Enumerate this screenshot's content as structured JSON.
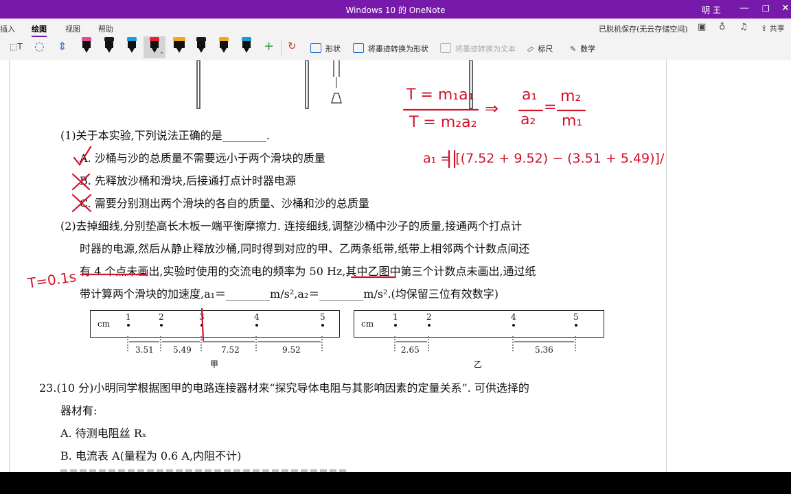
{
  "window": {
    "title": "Windows 10 的 OneNote",
    "user": "明 王"
  },
  "ribbon": {
    "tabs": [
      "插入",
      "绘图",
      "视图",
      "帮助"
    ],
    "active_tab": "绘图",
    "status": "已脱机保存(无云存储空间)",
    "share_label": "共享",
    "buttons": {
      "shape": "形状",
      "ink_to_shape": "将墨迹转换为形状",
      "ink_to_text": "将墨迹转换为文本",
      "ruler": "标尺",
      "math": "数学"
    },
    "pen_colors": [
      "#e14d8d",
      "#1a1a1a",
      "#18a0d8",
      "#e8222a",
      "#f2a81d",
      "#1a1a1a",
      "#f2a81d",
      "#1d9bd8"
    ]
  },
  "page": {
    "q1": {
      "stem": "(1)关于本实验,下列说法正确的是________.",
      "opt_a": "A. 沙桶与沙的总质量不需要远小于两个滑块的质量",
      "opt_b": "B. 先释放沙桶和滑块,后接通打点计时器电源",
      "opt_c": "C. 需要分别测出两个滑块的各自的质量、沙桶和沙的总质量"
    },
    "q2": {
      "line1": "(2)去掉细线,分别垫高长木板一端平衡摩擦力. 连接细线,调整沙桶中沙子的质量,接通两个打点计",
      "line2": "时器的电源,然后从静止释放沙桶,同时得到对应的甲、乙两条纸带,纸带上相邻两个计数点间还",
      "line3": "有 4 个点未画出,实验时使用的交流电的频率为 50 Hz,其中乙图中第三个计数点未画出,通过纸",
      "line4": "带计算两个滑块的加速度,a₁＝________m/s²,a₂＝________m/s².(均保留三位有效数字)"
    },
    "tape_jia": {
      "unit": "cm",
      "points": [
        "1",
        "2",
        "3",
        "4",
        "5"
      ],
      "gaps": [
        "3.51",
        "5.49",
        "7.52",
        "9.52"
      ],
      "label": "甲"
    },
    "tape_yi": {
      "unit": "cm",
      "points": [
        "1",
        "2",
        "4",
        "5"
      ],
      "gaps": [
        "2.65",
        "5.36"
      ],
      "label": "乙"
    },
    "q23": {
      "line1": "23.(10 分)小明同学根据图甲的电路连接器材来“探究导体电阻与其影响因素的定量关系”. 可供选择的",
      "line2": "器材有:",
      "opt_a": "A. 待测电阻丝 Rₓ",
      "opt_b": "B. 电流表 A(量程为 0.6 A,内阻不计)"
    },
    "ink": {
      "eq1": "T = m₁a₁",
      "eq2": "T = m₂a₂",
      "arrow": "⇒",
      "ratio_num_left": "a₁",
      "ratio_den_left": "a₂",
      "eq_sign": "=",
      "ratio_num_right": "m₂",
      "ratio_den_right": "m₁",
      "a1_expr": "a₁ = [(7.52 + 9.52) − (3.51 + 5.49)]/",
      "period": "T=0.1s"
    }
  }
}
